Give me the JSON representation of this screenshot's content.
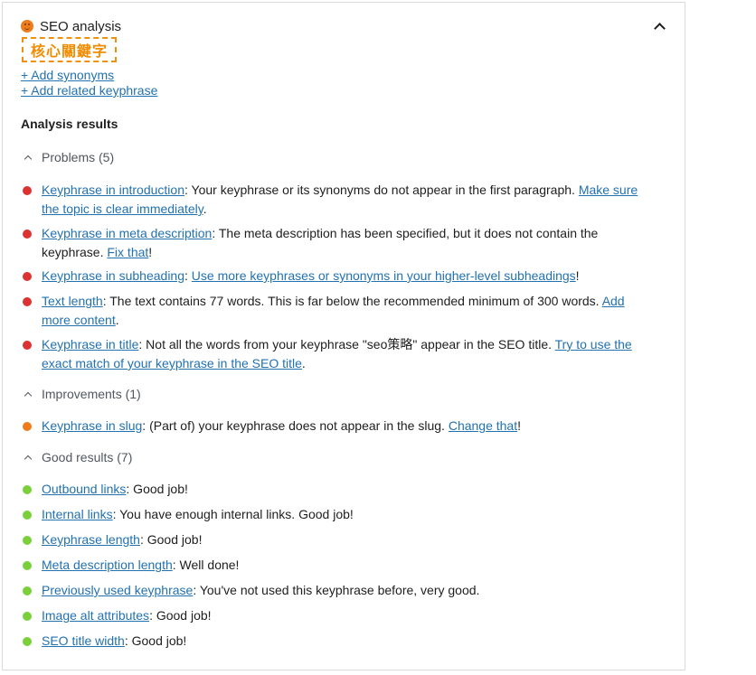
{
  "panel": {
    "title": "SEO analysis",
    "keyword_tag": "核心關鍵字",
    "add_synonyms": "+ Add synonyms",
    "add_related": "+ Add related keyphrase",
    "analysis_title": "Analysis results"
  },
  "colors": {
    "problem": "#dc3232",
    "improvement": "#ee7c1b",
    "good": "#7ad03a",
    "link": "#2271b1"
  },
  "problems": {
    "label": "Problems (5)",
    "items": [
      {
        "link": "Keyphrase in introduction",
        "text": ": Your keyphrase or its synonyms do not appear in the first paragraph. ",
        "link2": "Make sure the topic is clear immediately",
        "tail": "."
      },
      {
        "link": "Keyphrase in meta description",
        "text": ": The meta description has been specified, but it does not contain the keyphrase. ",
        "link2": "Fix that",
        "tail": "!"
      },
      {
        "link": "Keyphrase in subheading",
        "text": ": ",
        "link2": "Use more keyphrases or synonyms in your higher-level subheadings",
        "tail": "!"
      },
      {
        "link": "Text length",
        "text": ": The text contains 77 words. This is far below the recommended minimum of 300 words. ",
        "link2": "Add more content",
        "tail": "."
      },
      {
        "link": "Keyphrase in title",
        "text": ": Not all the words from your keyphrase \"seo策略\" appear in the SEO title. ",
        "link2": "Try to use the exact match of your keyphrase in the SEO title",
        "tail": "."
      }
    ]
  },
  "improvements": {
    "label": "Improvements (1)",
    "items": [
      {
        "link": "Keyphrase in slug",
        "text": ": (Part of) your keyphrase does not appear in the slug. ",
        "link2": "Change that",
        "tail": "!"
      }
    ]
  },
  "good": {
    "label": "Good results (7)",
    "items": [
      {
        "link": "Outbound links",
        "text": ": Good job!"
      },
      {
        "link": "Internal links",
        "text": ": You have enough internal links. Good job!"
      },
      {
        "link": "Keyphrase length",
        "text": ": Good job!"
      },
      {
        "link": "Meta description length",
        "text": ": Well done!"
      },
      {
        "link": "Previously used keyphrase",
        "text": ": You've not used this keyphrase before, very good."
      },
      {
        "link": "Image alt attributes",
        "text": ": Good job!"
      },
      {
        "link": "SEO title width",
        "text": ": Good job!"
      }
    ]
  }
}
